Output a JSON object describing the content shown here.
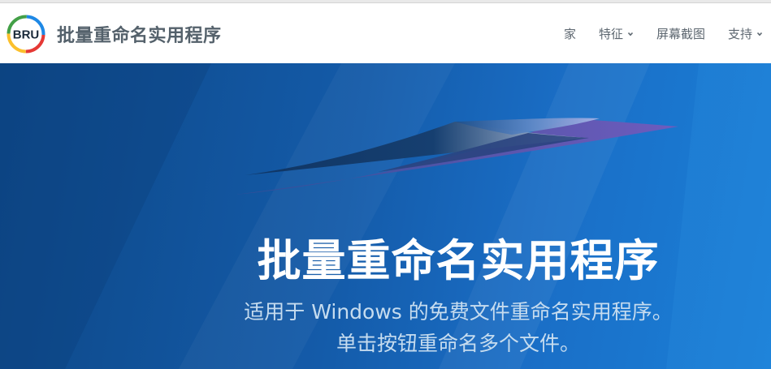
{
  "brand": {
    "logo_text": "BRU",
    "title": "批量重命名实用程序"
  },
  "nav": {
    "items": [
      {
        "label": "家",
        "dropdown": false
      },
      {
        "label": "特征",
        "dropdown": true
      },
      {
        "label": "屏幕截图",
        "dropdown": false
      },
      {
        "label": "支持",
        "dropdown": true
      }
    ]
  },
  "hero": {
    "title": "批量重命名实用程序",
    "subtitle_line1": "适用于 Windows 的免费文件重命名实用程序。",
    "subtitle_line2": "单击按钮重命名多个文件。"
  },
  "colors": {
    "hero_bg": "#145ba9",
    "nav_text": "#5d6770",
    "brand_text": "#54616b",
    "subtitle_text": "#c6dcef"
  }
}
